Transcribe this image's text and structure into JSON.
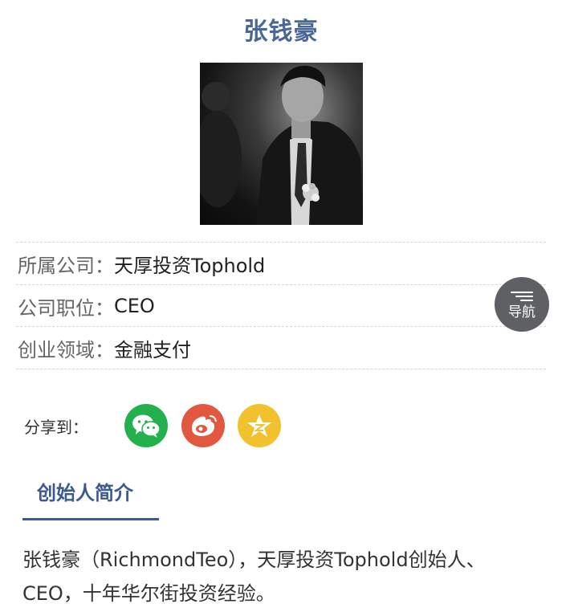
{
  "profile": {
    "name": "张钱豪"
  },
  "info": {
    "company_label": "所属公司：",
    "company_value": "天厚投资Tophold",
    "position_label": "公司职位：",
    "position_value": "CEO",
    "field_label": "创业领域：",
    "field_value": "金融支付"
  },
  "nav_button": {
    "label": "导航",
    "icon": "menu-lines-icon"
  },
  "share": {
    "label": "分享到：",
    "targets": [
      {
        "name": "wechat",
        "icon": "wechat-icon",
        "color": "#22b14c"
      },
      {
        "name": "weibo",
        "icon": "weibo-icon",
        "color": "#e2573f"
      },
      {
        "name": "qzone",
        "icon": "qzone-star-icon",
        "color": "#f2c12e"
      }
    ]
  },
  "tabs": {
    "founder_intro": "创始人简介"
  },
  "bio": {
    "text": "张钱豪（RichmondTeo），天厚投资Tophold创始人、CEO，十年华尔街投资经验。"
  },
  "colors": {
    "accent": "#3c5a91",
    "title": "#4a6795"
  }
}
